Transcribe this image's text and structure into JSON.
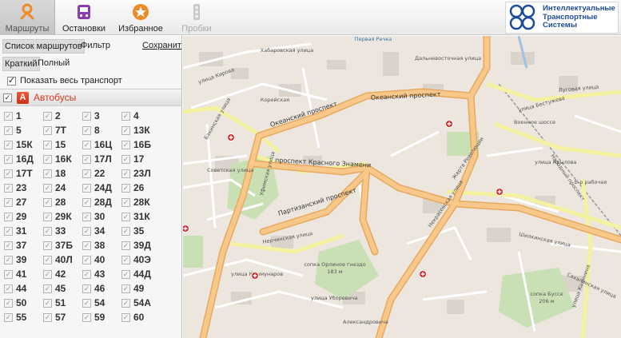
{
  "nav": {
    "routes": "Маршруты",
    "stops": "Остановки",
    "favorites": "Избранное",
    "traffic": "Пробки"
  },
  "logo": {
    "line1": "Интеллектуальные",
    "line2": "Транспортные",
    "line3": "Системы"
  },
  "panel": {
    "tabs": {
      "routes": "Список маршрутов",
      "filter": "Фильтр",
      "save": "Сохранить"
    },
    "modes": {
      "short": "Краткий",
      "full": "Полный"
    },
    "show_all": "Показать весь транспорт",
    "bus_section": {
      "icon": "А",
      "title": "Автобусы"
    },
    "routes": [
      "1",
      "2",
      "3",
      "4",
      "5",
      "7Т",
      "8",
      "13К",
      "15К",
      "15",
      "16Ц",
      "16Б",
      "16Д",
      "16К",
      "17Л",
      "17",
      "17Т",
      "18",
      "22",
      "23Л",
      "23",
      "24",
      "24Д",
      "26",
      "27",
      "28",
      "28Д",
      "28К",
      "29",
      "29К",
      "30",
      "31К",
      "31",
      "33",
      "34",
      "35",
      "37",
      "37Б",
      "38",
      "39Д",
      "39",
      "40Л",
      "40",
      "40Э",
      "41",
      "42",
      "43",
      "44Д",
      "44",
      "45",
      "46",
      "49",
      "50",
      "51",
      "54",
      "54А",
      "55",
      "57",
      "59",
      "60"
    ]
  },
  "map": {
    "avenues": {
      "okeansky": "Океанский проспект",
      "krasnogo_znameni": "проспект Красного Знамени",
      "partizansky": "Партизанский проспект"
    },
    "streets": {
      "kirova": "улица Кирова",
      "sovetskaya": "Советская улица",
      "nerchinskaya": "Нерчинская улица",
      "nekrasovskaya": "Некрасовская улица",
      "kommunarov": "улица Коммунаров",
      "uborevicha": "улица Уборевича",
      "dalnevostochnaya": "Дальневосточная улица",
      "zhertv": "Жертв Революции",
      "bestuzheva": "улица Бестужева",
      "shilkinskaya": "Шилкинская улица",
      "krylova": "улица Крылова",
      "lugovaya": "Луговая улица",
      "sakhalinskaya": "Сахалинская улица",
      "narodny": "Народный проспект",
      "bakinskaya": "Бакинская улица",
      "alexandrovicha": "Александровича",
      "ufimskaya": "Уфимская улица",
      "kalininа": "улица Калинина"
    },
    "places": {
      "pervaya_rechka": "Первая Речка",
      "voennoe_shosse": "Военное шоссе",
      "khabarovskaya": "Хабаровская улица",
      "egersheld": "Е-р рабочая",
      "sopka_ornitologa": "сопка Орлиное гнездо",
      "sopka_ornitologa_h": "183 м",
      "sopka_busse": "сопка Буссе",
      "sopka_busse_h": "206 м",
      "koreyskaya": "Корейская"
    }
  },
  "colors": {
    "accent_orange": "#f08a24",
    "bus_red": "#d43a1f",
    "logo_blue": "#1c4b9c",
    "road_major": "#f7c88a",
    "road_secondary": "#f4f2a0",
    "map_bg": "#eae4dc"
  }
}
